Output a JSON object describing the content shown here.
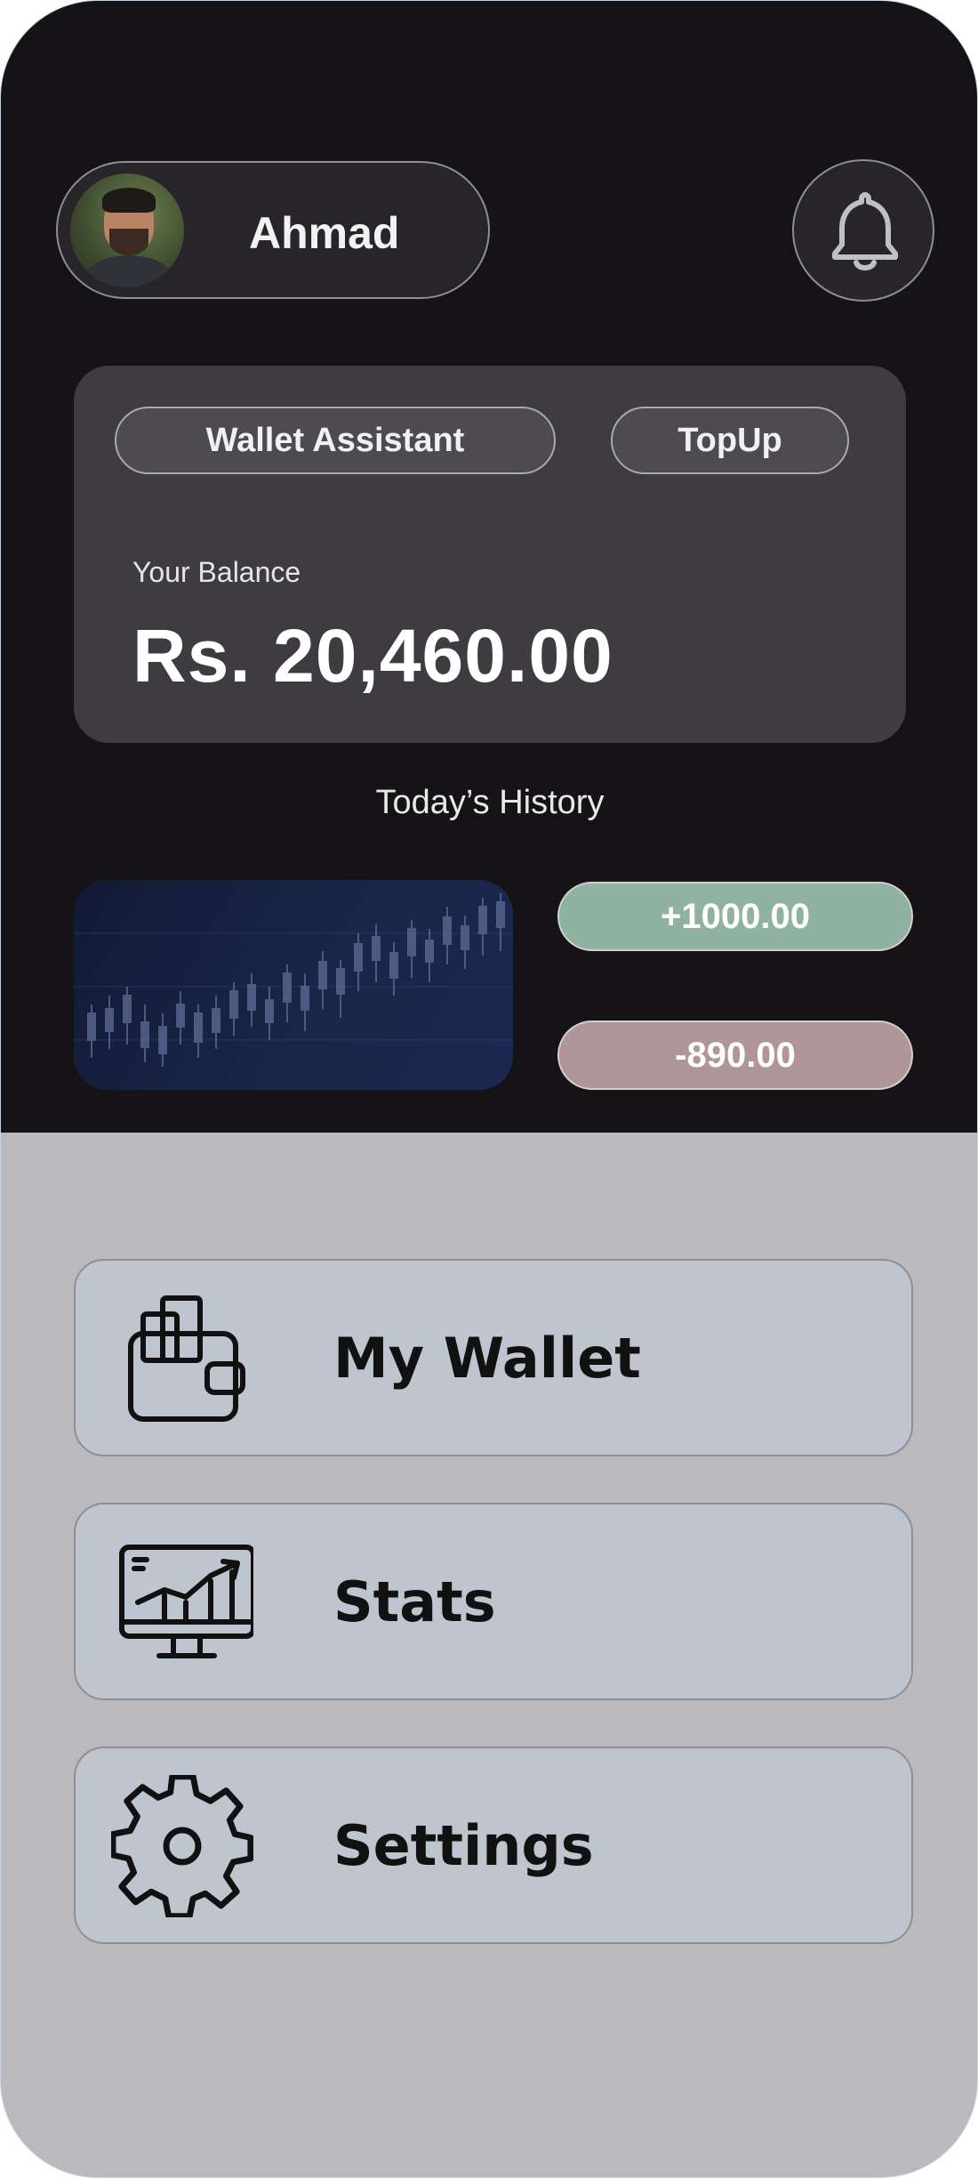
{
  "profile": {
    "name": "Ahmad"
  },
  "actions": {
    "assistant_label": "Wallet Assistant",
    "topup_label": "TopUp"
  },
  "balance": {
    "label": "Your Balance",
    "value": "Rs. 20,460.00"
  },
  "history": {
    "title": "Today’s History",
    "income": "+1000.00",
    "expense": "-890.00"
  },
  "menu": {
    "wallet_label": "My Wallet",
    "stats_label": "Stats",
    "settings_label": "Settings"
  },
  "colors": {
    "header_bg": "#151316",
    "card_bg": "#3e3c40",
    "income": "#8fb3a0",
    "expense": "#b09698",
    "menu_bg": "#bec5cf",
    "page_bg": "#bab9bd"
  }
}
